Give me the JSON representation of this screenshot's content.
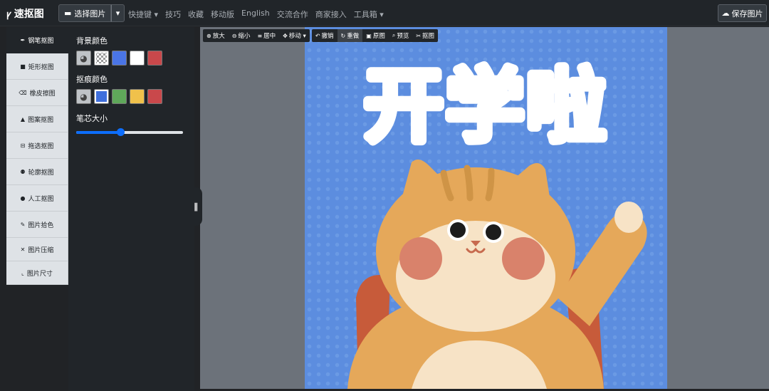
{
  "navbar": {
    "brand_icon": "crop-icon",
    "brand_icon_glyph": "ꝩ",
    "brand": "速抠图",
    "select_image": "选择图片",
    "links": [
      "快捷键 ▾",
      "技巧",
      "收藏",
      "移动版",
      "English",
      "交流合作",
      "商家接入",
      "工具箱 ▾"
    ],
    "save": "保存图片"
  },
  "tabs": [
    {
      "label": "钢笔抠图",
      "icon": "pen-icon",
      "glyph": "✒",
      "active": true
    },
    {
      "label": "矩形抠图",
      "icon": "rectangle-icon",
      "glyph": "■",
      "active": false
    },
    {
      "label": "橡皮擦图",
      "icon": "eraser-icon",
      "glyph": "⌫",
      "active": false
    },
    {
      "label": "图案抠图",
      "icon": "shapes-icon",
      "glyph": "▲",
      "active": false
    },
    {
      "label": "拖选抠图",
      "icon": "drag-select-icon",
      "glyph": "⊟",
      "active": false
    },
    {
      "label": "轮廓抠图",
      "icon": "robot-icon",
      "glyph": "⚉",
      "active": false
    },
    {
      "label": "人工抠图",
      "icon": "person-icon",
      "glyph": "●",
      "active": false
    },
    {
      "label": "图片拾色",
      "icon": "eyedropper-icon",
      "glyph": "✎",
      "active": false
    },
    {
      "label": "图片压缩",
      "icon": "compress-icon",
      "glyph": "✕",
      "active": false
    },
    {
      "label": "图片尺寸",
      "icon": "ruler-icon",
      "glyph": "⌞",
      "active": false
    }
  ],
  "panel": {
    "bg_color_label": "背景颜色",
    "bg_swatches": [
      {
        "name": "palette",
        "color": "#bfc3c7"
      },
      {
        "name": "transparent",
        "color": "checker"
      },
      {
        "name": "blue",
        "color": "#4a75e6"
      },
      {
        "name": "white",
        "color": "#ffffff"
      },
      {
        "name": "red",
        "color": "#c9484b"
      }
    ],
    "bg_selected": 1,
    "trace_color_label": "抠痕颜色",
    "trace_swatches": [
      {
        "name": "palette",
        "color": "#bfc3c7"
      },
      {
        "name": "blue",
        "color": "#3f6fdc"
      },
      {
        "name": "green",
        "color": "#5fa85a"
      },
      {
        "name": "yellow",
        "color": "#f0c14b"
      },
      {
        "name": "red",
        "color": "#c9484b"
      }
    ],
    "trace_selected": 1,
    "brush_size_label": "笔芯大小",
    "brush_size_fraction": 0.41
  },
  "toolbar": {
    "groups": [
      [
        {
          "label": "放大",
          "icon": "zoom-in-icon",
          "glyph": "⊕"
        },
        {
          "label": "缩小",
          "icon": "zoom-out-icon",
          "glyph": "⊖"
        },
        {
          "label": "居中",
          "icon": "align-center-icon",
          "glyph": "≡"
        },
        {
          "label": "移动 ▾",
          "icon": "move-icon",
          "glyph": "✥"
        }
      ],
      [
        {
          "label": "撤销",
          "icon": "undo-icon",
          "glyph": "↶",
          "active": false
        },
        {
          "label": "重做",
          "icon": "redo-icon",
          "glyph": "↻",
          "active": true
        },
        {
          "label": "原图",
          "icon": "image-icon",
          "glyph": "▣",
          "active": false
        },
        {
          "label": "预览",
          "icon": "search-icon",
          "glyph": "⌕",
          "active": false
        },
        {
          "label": "抠图",
          "icon": "scissors-icon",
          "glyph": "✂",
          "active": false
        }
      ]
    ]
  },
  "image": {
    "headline": "开学啦",
    "bg_color": "#5c8ddf"
  },
  "colors": {
    "navbar": "#212529",
    "canvas_bg": "#6c727a",
    "tab_bg": "#dee2e6",
    "slider": "#0d6efd"
  }
}
